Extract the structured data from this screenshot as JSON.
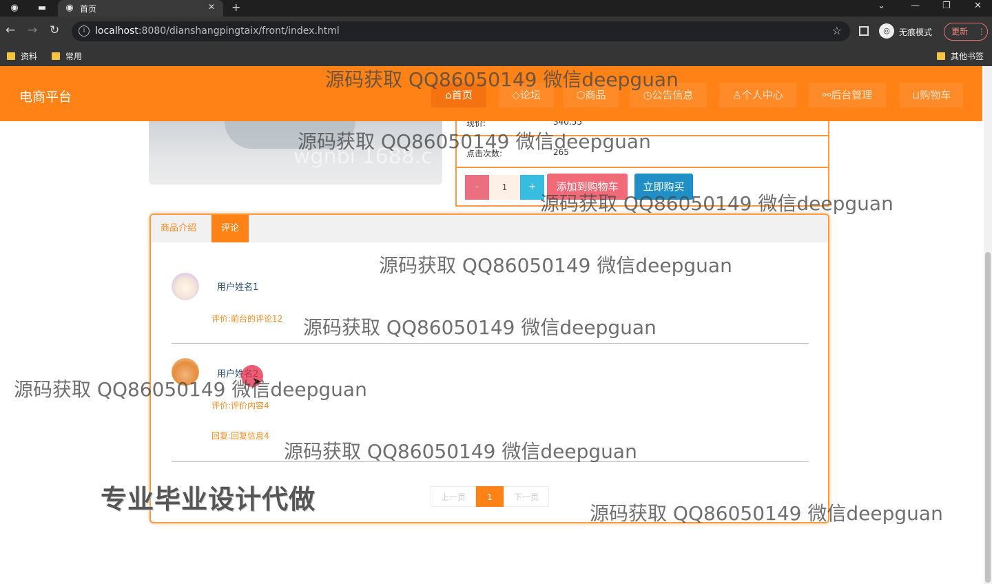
{
  "browser": {
    "tab_title": "首页",
    "url_host": "localhost",
    "url_rest": ":8080/dianshangpingtaix/front/index.html",
    "profile_label": "无痕模式",
    "update_label": "更新",
    "bookmarks": [
      "资料",
      "常用"
    ],
    "other_bookmarks": "其他书签"
  },
  "site": {
    "brand": "电商平台",
    "nav": [
      {
        "label": "首页",
        "icon": "home-icon",
        "glyph": "⌂",
        "active": true
      },
      {
        "label": "论坛",
        "icon": "tag-icon",
        "glyph": "◇",
        "active": false
      },
      {
        "label": "商品",
        "icon": "box-icon",
        "glyph": "⬡",
        "active": false
      },
      {
        "label": "公告信息",
        "icon": "clock-icon",
        "glyph": "◷",
        "active": false
      },
      {
        "label": "个人中心",
        "icon": "user-icon",
        "glyph": "♙",
        "active": false
      },
      {
        "label": "后台管理",
        "icon": "link-icon",
        "glyph": "⚯",
        "active": false
      },
      {
        "label": "购物车",
        "icon": "cart-icon",
        "glyph": "⊔",
        "active": false
      }
    ]
  },
  "product": {
    "image_watermark": "wgnbi 1688.c",
    "price_label": "现价:",
    "price_value": "340.55",
    "clicks_label": "点击次数:",
    "clicks_value": "265",
    "qty_minus": "-",
    "qty_value": "1",
    "qty_plus": "+",
    "add_cart": "添加到购物车",
    "buy_now": "立即购买"
  },
  "tabs": [
    {
      "label": "商品介绍",
      "active": false
    },
    {
      "label": "评论",
      "active": true
    }
  ],
  "comments": [
    {
      "user": "用户姓名1",
      "text": "评价:前台的评论12",
      "reply": ""
    },
    {
      "user": "用户姓名2",
      "text": "评价:评价内容4",
      "reply": "回复:回复信息4"
    }
  ],
  "pager": {
    "prev": "上一页",
    "current": "1",
    "next": "下一页"
  },
  "overlay": {
    "watermark": "源码获取 QQ86050149 微信deepguan",
    "promo": "专业毕业设计代做"
  },
  "colors": {
    "brand_orange": "#ff8217",
    "cart_pink": "#f06a78",
    "buy_blue": "#1f8fc6"
  }
}
